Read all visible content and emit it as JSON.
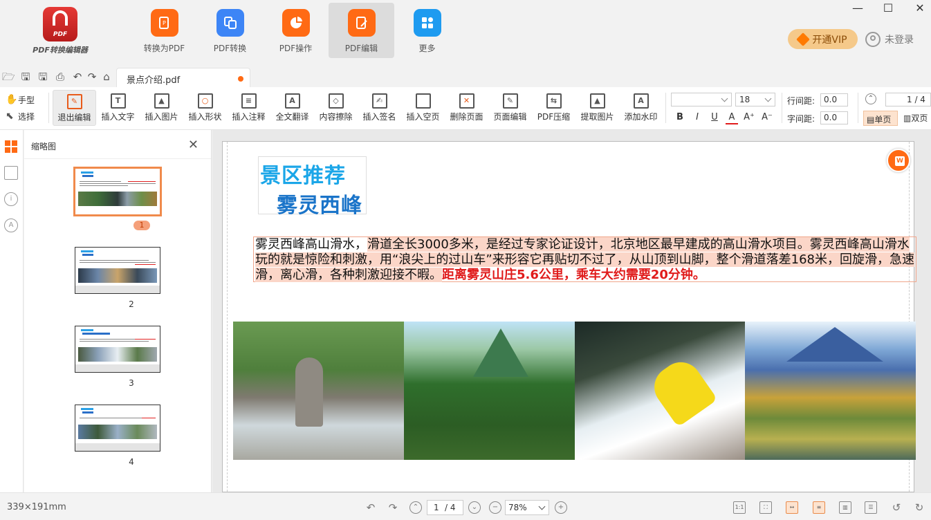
{
  "app": {
    "logo_badge": "PDF",
    "logo_text": "PDF转换编辑器"
  },
  "topnav": [
    {
      "label": "转换为PDF",
      "icon": "to-pdf-icon"
    },
    {
      "label": "PDF转换",
      "icon": "pdf-convert-icon"
    },
    {
      "label": "PDF操作",
      "icon": "pdf-operate-icon"
    },
    {
      "label": "PDF编辑",
      "icon": "pdf-edit-icon",
      "active": true
    },
    {
      "label": "更多",
      "icon": "more-icon"
    }
  ],
  "account": {
    "vip_label": "开通VIP",
    "login_label": "未登录"
  },
  "file_tab": {
    "name": "景点介绍.pdf",
    "unsaved": true
  },
  "ribbon": {
    "hand_label": "手型",
    "select_label": "选择",
    "tools": [
      {
        "label": "退出编辑",
        "icon": "exit-edit-icon",
        "active": true
      },
      {
        "label": "插入文字",
        "icon": "insert-text-icon"
      },
      {
        "label": "插入图片",
        "icon": "insert-image-icon"
      },
      {
        "label": "插入形状",
        "icon": "insert-shape-icon"
      },
      {
        "label": "插入注释",
        "icon": "insert-comment-icon"
      },
      {
        "label": "全文翻译",
        "icon": "translate-icon"
      },
      {
        "label": "内容擦除",
        "icon": "eraser-icon"
      },
      {
        "label": "插入签名",
        "icon": "signature-icon"
      },
      {
        "label": "插入空页",
        "icon": "blank-page-icon"
      },
      {
        "label": "删除页面",
        "icon": "delete-page-icon"
      },
      {
        "label": "页面编辑",
        "icon": "page-edit-icon"
      },
      {
        "label": "PDF压缩",
        "icon": "compress-icon"
      },
      {
        "label": "提取图片",
        "icon": "extract-image-icon"
      },
      {
        "label": "添加水印",
        "icon": "watermark-icon"
      }
    ],
    "font_family": "",
    "font_size": "18",
    "format": {
      "bold": "B",
      "italic": "I",
      "underline": "U",
      "color": "A",
      "grow": "A⁺",
      "shrink": "A⁻"
    },
    "line_spacing_label": "行间距:",
    "line_spacing_value": "0.0",
    "char_spacing_label": "字间距:",
    "char_spacing_value": "0.0",
    "page_top": "1 / 4",
    "single_page_label": "单页",
    "double_page_label": "双页"
  },
  "sidebar": {
    "title": "缩略图",
    "thumbnails": [
      {
        "num": "1",
        "selected": true
      },
      {
        "num": "2",
        "selected": false
      },
      {
        "num": "3",
        "selected": false
      },
      {
        "num": "4",
        "selected": false
      }
    ]
  },
  "document": {
    "title_line1": "景区推荐",
    "title_line2": "雾灵西峰",
    "para_plain": "雾灵西峰高山滑水，",
    "para_highlight": "滑道全长3000多米，是经过专家论证设计，北京地区最早建成的高山滑水项目。雾灵西峰高山滑水玩的就是惊险和刺激，用“浪尖上的过山车”来形容它再贴切不过了，从山顶到山脚，整个滑道落差168米，回旋滑，急速滑，离心滑，各种刺激迎接不暇。",
    "para_red": "距离雾灵山庄5.6公里，乘车大约需要20分钟。",
    "photos": [
      "scenic-photo-rocks",
      "scenic-photo-valley",
      "scenic-photo-rafting",
      "scenic-photo-autumn"
    ]
  },
  "status": {
    "dimensions": "339×191mm",
    "current_page": "1",
    "total_pages": "/ 4",
    "zoom": "78%"
  },
  "colors": {
    "accent": "#ff6a14",
    "title_blue": "#1ba6e8",
    "title_dark_blue": "#1a74c9",
    "red_text": "#e01b1b"
  }
}
